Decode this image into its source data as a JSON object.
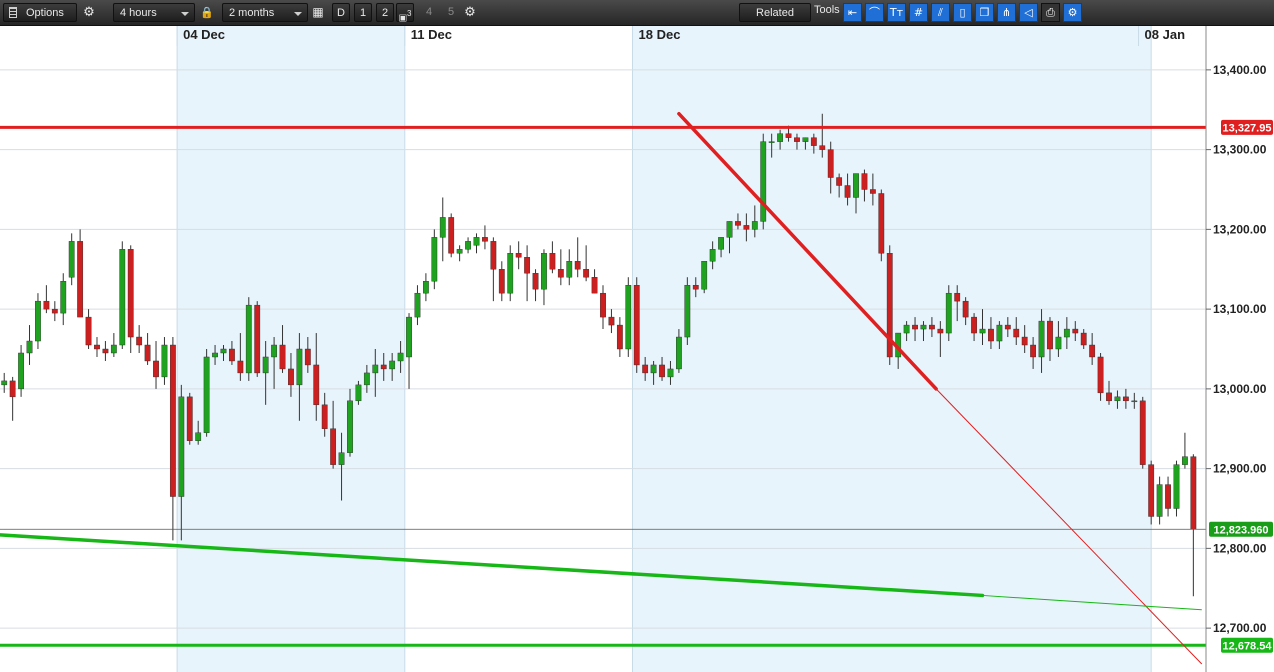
{
  "toolbar": {
    "options_label": "Options",
    "interval": "4 hours",
    "range": "2 months",
    "d_label": "D",
    "b1": "1",
    "b2": "2",
    "b3_sup": "3",
    "b4": "4",
    "b5": "5",
    "related_label": "Related",
    "tools_label": "Tools",
    "tools": [
      "arrow-left-icon",
      "curve-icon",
      "text-icon",
      "grid-icon",
      "fibonacci-icon",
      "candle-icon",
      "copy-icon",
      "pitchfork-icon",
      "label-icon",
      "print-icon",
      "settings-icon"
    ]
  },
  "colors": {
    "up": "#1fa21f",
    "down": "#cc1f1f",
    "band": "#e8f4fc",
    "resistance": "#e02020",
    "support": "#16b716",
    "current": "#1a9e1a"
  },
  "chart_data": {
    "type": "candlestick",
    "x_labels": [
      {
        "label": "04 Dec",
        "bar": 21
      },
      {
        "label": "11 Dec",
        "bar": 48
      },
      {
        "label": "18 Dec",
        "bar": 75
      },
      {
        "label": "08 Jan",
        "bar": 135
      }
    ],
    "y_ticks": [
      "13,400.00",
      "13,300.00",
      "13,200.00",
      "13,100.00",
      "13,000.00",
      "12,900.00",
      "12,800.00",
      "12,700.00"
    ],
    "y_tick_values": [
      13400,
      13300,
      13200,
      13100,
      13000,
      12900,
      12800,
      12700
    ],
    "ylim": [
      12645,
      13455
    ],
    "xlim": [
      -0.5,
      142.5
    ],
    "shaded_bar_ranges": [
      [
        21,
        47.5
      ],
      [
        75,
        136
      ]
    ],
    "horizontal_lines": [
      {
        "value": 13327.95,
        "label": "13,327.95",
        "color": "resistance"
      },
      {
        "value": 12678.54,
        "label": "12,678.54",
        "color": "support"
      }
    ],
    "current_price": {
      "value": 12823.96,
      "label": "12,823.960"
    },
    "trendlines": [
      {
        "color": "resistance",
        "from": [
          80,
          13345
        ],
        "to": [
          110.5,
          13000
        ],
        "extend_to": [
          142,
          12655
        ]
      },
      {
        "color": "support",
        "from": [
          -0.5,
          12817
        ],
        "to": [
          116,
          12741
        ],
        "extend_to": [
          142,
          12723
        ]
      }
    ],
    "candles": [
      [
        13005,
        13020,
        12995,
        13010
      ],
      [
        13010,
        13015,
        12960,
        12990
      ],
      [
        13000,
        13055,
        12990,
        13045
      ],
      [
        13045,
        13080,
        13030,
        13060
      ],
      [
        13060,
        13120,
        13050,
        13110
      ],
      [
        13110,
        13130,
        13095,
        13100
      ],
      [
        13100,
        13110,
        13085,
        13095
      ],
      [
        13095,
        13145,
        13080,
        13135
      ],
      [
        13140,
        13195,
        13130,
        13185
      ],
      [
        13185,
        13200,
        13105,
        13090
      ],
      [
        13090,
        13100,
        13050,
        13055
      ],
      [
        13055,
        13065,
        13040,
        13050
      ],
      [
        13050,
        13060,
        13035,
        13045
      ],
      [
        13045,
        13070,
        13040,
        13055
      ],
      [
        13055,
        13185,
        13050,
        13175
      ],
      [
        13175,
        13180,
        13045,
        13065
      ],
      [
        13065,
        13080,
        13045,
        13055
      ],
      [
        13055,
        13070,
        13030,
        13035
      ],
      [
        13035,
        13060,
        13000,
        13015
      ],
      [
        13015,
        13065,
        13005,
        13055
      ],
      [
        13055,
        13065,
        12810,
        12865
      ],
      [
        12865,
        13005,
        12810,
        12990
      ],
      [
        12990,
        12995,
        12930,
        12935
      ],
      [
        12935,
        12960,
        12930,
        12945
      ],
      [
        12945,
        13050,
        12940,
        13040
      ],
      [
        13040,
        13055,
        13030,
        13045
      ],
      [
        13045,
        13055,
        13035,
        13050
      ],
      [
        13050,
        13060,
        13030,
        13035
      ],
      [
        13035,
        13070,
        13010,
        13020
      ],
      [
        13020,
        13115,
        13010,
        13105
      ],
      [
        13105,
        13110,
        13015,
        13020
      ],
      [
        13020,
        13060,
        12980,
        13040
      ],
      [
        13040,
        13065,
        13000,
        13055
      ],
      [
        13055,
        13080,
        13020,
        13025
      ],
      [
        13025,
        13045,
        12990,
        13005
      ],
      [
        13005,
        13070,
        12960,
        13050
      ],
      [
        13050,
        13065,
        13020,
        13030
      ],
      [
        13030,
        13070,
        12960,
        12980
      ],
      [
        12980,
        12995,
        12940,
        12950
      ],
      [
        12950,
        12985,
        12900,
        12905
      ],
      [
        12905,
        12945,
        12860,
        12920
      ],
      [
        12920,
        13000,
        12915,
        12985
      ],
      [
        12985,
        13010,
        12980,
        13005
      ],
      [
        13005,
        13030,
        12995,
        13020
      ],
      [
        13020,
        13050,
        12990,
        13030
      ],
      [
        13030,
        13045,
        13010,
        13025
      ],
      [
        13025,
        13045,
        13010,
        13035
      ],
      [
        13035,
        13060,
        13020,
        13045
      ],
      [
        13040,
        13095,
        13000,
        13090
      ],
      [
        13090,
        13130,
        13080,
        13120
      ],
      [
        13120,
        13145,
        13110,
        13135
      ],
      [
        13135,
        13200,
        13125,
        13190
      ],
      [
        13190,
        13240,
        13160,
        13215
      ],
      [
        13215,
        13220,
        13165,
        13170
      ],
      [
        13170,
        13180,
        13160,
        13175
      ],
      [
        13175,
        13190,
        13170,
        13185
      ],
      [
        13180,
        13195,
        13170,
        13190
      ],
      [
        13190,
        13205,
        13175,
        13185
      ],
      [
        13185,
        13190,
        13110,
        13150
      ],
      [
        13150,
        13160,
        13110,
        13120
      ],
      [
        13120,
        13180,
        13110,
        13170
      ],
      [
        13170,
        13185,
        13150,
        13165
      ],
      [
        13165,
        13180,
        13110,
        13145
      ],
      [
        13145,
        13150,
        13110,
        13125
      ],
      [
        13125,
        13175,
        13105,
        13170
      ],
      [
        13170,
        13185,
        13145,
        13150
      ],
      [
        13150,
        13175,
        13130,
        13140
      ],
      [
        13140,
        13175,
        13130,
        13160
      ],
      [
        13160,
        13190,
        13140,
        13150
      ],
      [
        13150,
        13180,
        13135,
        13140
      ],
      [
        13140,
        13150,
        13120,
        13120
      ],
      [
        13120,
        13130,
        13075,
        13090
      ],
      [
        13090,
        13100,
        13070,
        13080
      ],
      [
        13080,
        13090,
        13040,
        13050
      ],
      [
        13050,
        13140,
        13040,
        13130
      ],
      [
        13130,
        13140,
        13020,
        13030
      ],
      [
        13030,
        13040,
        13010,
        13020
      ],
      [
        13020,
        13035,
        13005,
        13030
      ],
      [
        13030,
        13040,
        13010,
        13015
      ],
      [
        13015,
        13035,
        13005,
        13025
      ],
      [
        13025,
        13075,
        13020,
        13065
      ],
      [
        13065,
        13140,
        13055,
        13130
      ],
      [
        13130,
        13140,
        13115,
        13125
      ],
      [
        13125,
        13145,
        13120,
        13160
      ],
      [
        13160,
        13185,
        13150,
        13175
      ],
      [
        13175,
        13185,
        13165,
        13190
      ],
      [
        13190,
        13210,
        13170,
        13210
      ],
      [
        13210,
        13220,
        13200,
        13205
      ],
      [
        13205,
        13220,
        13185,
        13200
      ],
      [
        13200,
        13230,
        13190,
        13210
      ],
      [
        13210,
        13320,
        13200,
        13310
      ],
      [
        13310,
        13320,
        13290,
        13310
      ],
      [
        13310,
        13325,
        13300,
        13320
      ],
      [
        13320,
        13330,
        13310,
        13315
      ],
      [
        13315,
        13320,
        13300,
        13310
      ],
      [
        13310,
        13315,
        13300,
        13315
      ],
      [
        13315,
        13320,
        13295,
        13305
      ],
      [
        13305,
        13345,
        13290,
        13300
      ],
      [
        13300,
        13310,
        13245,
        13265
      ],
      [
        13265,
        13270,
        13240,
        13255
      ],
      [
        13255,
        13270,
        13230,
        13240
      ],
      [
        13240,
        13270,
        13220,
        13270
      ],
      [
        13270,
        13275,
        13235,
        13250
      ],
      [
        13250,
        13270,
        13230,
        13245
      ],
      [
        13245,
        13250,
        13160,
        13170
      ],
      [
        13170,
        13180,
        13030,
        13040
      ],
      [
        13040,
        13070,
        13025,
        13070
      ],
      [
        13070,
        13085,
        13060,
        13080
      ],
      [
        13080,
        13090,
        13060,
        13075
      ],
      [
        13075,
        13085,
        13060,
        13080
      ],
      [
        13080,
        13090,
        13065,
        13075
      ],
      [
        13075,
        13085,
        13040,
        13070
      ],
      [
        13070,
        13130,
        13060,
        13120
      ],
      [
        13120,
        13130,
        13085,
        13110
      ],
      [
        13110,
        13115,
        13080,
        13090
      ],
      [
        13090,
        13095,
        13060,
        13070
      ],
      [
        13070,
        13100,
        13055,
        13075
      ],
      [
        13075,
        13090,
        13050,
        13060
      ],
      [
        13060,
        13085,
        13050,
        13080
      ],
      [
        13080,
        13090,
        13065,
        13075
      ],
      [
        13075,
        13090,
        13055,
        13065
      ],
      [
        13065,
        13080,
        13045,
        13055
      ],
      [
        13055,
        13065,
        13025,
        13040
      ],
      [
        13040,
        13100,
        13020,
        13085
      ],
      [
        13085,
        13090,
        13035,
        13050
      ],
      [
        13050,
        13085,
        13040,
        13065
      ],
      [
        13065,
        13090,
        13050,
        13075
      ],
      [
        13075,
        13085,
        13060,
        13070
      ],
      [
        13070,
        13075,
        13050,
        13055
      ],
      [
        13055,
        13070,
        13030,
        13040
      ],
      [
        13040,
        13045,
        12985,
        12995
      ],
      [
        12995,
        13010,
        12980,
        12985
      ],
      [
        12985,
        12998,
        12975,
        12990
      ],
      [
        12990,
        13000,
        12975,
        12985
      ],
      [
        12985,
        12995,
        12975,
        12985
      ],
      [
        12985,
        12990,
        12900,
        12905
      ],
      [
        12905,
        12910,
        12830,
        12840
      ],
      [
        12840,
        12890,
        12830,
        12880
      ],
      [
        12880,
        12890,
        12840,
        12850
      ],
      [
        12850,
        12910,
        12840,
        12905
      ],
      [
        12905,
        12945,
        12900,
        12915
      ],
      [
        12915,
        12918,
        12740,
        12823.96
      ]
    ]
  }
}
